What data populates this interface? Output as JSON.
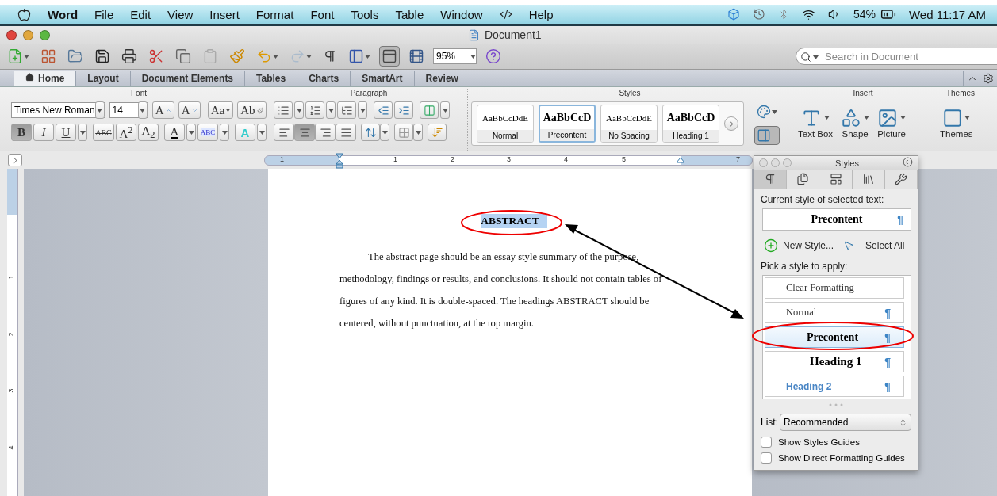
{
  "menu_bar": {
    "app": "Word",
    "menus": [
      "File",
      "Edit",
      "View",
      "Insert",
      "Format",
      "Font",
      "Tools",
      "Table",
      "Window",
      "Help"
    ],
    "battery": "54%",
    "clock": "Wed 11:17 AM"
  },
  "window": {
    "title": "Document1"
  },
  "toolbar": {
    "zoom": "95%",
    "search_placeholder": "Search in Document"
  },
  "ribbon_tabs": [
    {
      "label": "Home",
      "selected": true
    },
    {
      "label": "Layout",
      "selected": false
    },
    {
      "label": "Document Elements",
      "selected": false
    },
    {
      "label": "Tables",
      "selected": false
    },
    {
      "label": "Charts",
      "selected": false
    },
    {
      "label": "SmartArt",
      "selected": false
    },
    {
      "label": "Review",
      "selected": false
    }
  ],
  "ribbon": {
    "font": {
      "title": "Font",
      "name": "Times New Roman",
      "size": "14",
      "row1": [
        {
          "kind": "grow",
          "label": "A"
        },
        {
          "kind": "shrink",
          "label": "A"
        },
        {
          "kind": "case",
          "label": "Aa"
        },
        {
          "kind": "clear",
          "label": "Ab"
        }
      ],
      "row2": [
        {
          "kind": "bold",
          "label": "B",
          "pressed": true
        },
        {
          "kind": "italic",
          "label": "I",
          "pressed": false
        },
        {
          "kind": "underline",
          "label": "U",
          "pressed": false
        },
        {
          "kind": "strike",
          "label": "ABC",
          "pressed": false
        },
        {
          "kind": "super",
          "label": "A$^{2}$",
          "pressed": false
        },
        {
          "kind": "sub",
          "label": "A$_{2}$",
          "pressed": false
        },
        {
          "kind": "color",
          "label": "A",
          "pressed": false
        },
        {
          "kind": "highlight",
          "label": "ABC",
          "pressed": false
        },
        {
          "kind": "effects",
          "label": "A",
          "pressed": false
        }
      ]
    },
    "paragraph": {
      "title": "Paragraph",
      "alignments": [
        {
          "selected": false
        },
        {
          "selected": true
        },
        {
          "selected": false
        },
        {
          "selected": false
        }
      ]
    },
    "styles": {
      "title": "Styles",
      "items": [
        {
          "sample": "AaBbCcDdE",
          "name": "Normal",
          "bold": false,
          "selected": false
        },
        {
          "sample": "AaBbCcD",
          "name": "Precontent",
          "bold": true,
          "selected": true
        },
        {
          "sample": "AaBbCcDdE",
          "name": "No Spacing",
          "bold": false,
          "selected": false
        },
        {
          "sample": "AaBbCcD",
          "name": "Heading 1",
          "bold": true,
          "selected": false
        }
      ]
    },
    "insert": {
      "title": "Insert",
      "items": [
        "Text Box",
        "Shape",
        "Picture"
      ]
    },
    "themes": {
      "title": "Themes",
      "label": "Themes"
    }
  },
  "ruler": {
    "numbers": [
      "1",
      "1",
      "2",
      "3",
      "4",
      "5",
      "7"
    ]
  },
  "vertical_ruler": {
    "numbers": [
      "1",
      "2",
      "3",
      "4"
    ]
  },
  "document": {
    "heading": "ABSTRACT",
    "heading_selected": true,
    "paragraph_lines": [
      "The abstract page should be an essay style summary of the purpose,",
      "methodology, findings or results, and conclusions.  It should not contain tables of",
      "figures of any kind.  It is double-spaced.  The headings ABSTRACT should be",
      "centered, without punctuation, at the top margin."
    ]
  },
  "styles_pane": {
    "title": "Styles",
    "tabs": [
      {
        "selected": true
      },
      {
        "selected": false
      },
      {
        "selected": false
      },
      {
        "selected": false
      },
      {
        "selected": false
      }
    ],
    "current_label": "Current style of selected text:",
    "current_style": "Precontent",
    "current_mark": "¶",
    "new_style": "New Style...",
    "select_all": "Select All",
    "pick_label": "Pick a style to apply:",
    "styles": [
      {
        "name": "Clear Formatting",
        "kind": "clear",
        "selected": false
      },
      {
        "name": "Normal",
        "kind": "normal",
        "mark": "¶",
        "selected": false
      },
      {
        "name": "Precontent",
        "kind": "bold",
        "mark": "¶",
        "selected": true
      },
      {
        "name": "Heading 1",
        "kind": "heading1",
        "mark": "¶",
        "selected": false
      },
      {
        "name": "Heading 2",
        "kind": "heading2",
        "mark": "¶",
        "selected": false
      }
    ],
    "list_label": "List:",
    "list_value": "Recommended",
    "options": [
      {
        "label": "Show Styles Guides",
        "checked": false
      },
      {
        "label": "Show Direct Formatting Guides",
        "checked": false
      }
    ]
  }
}
